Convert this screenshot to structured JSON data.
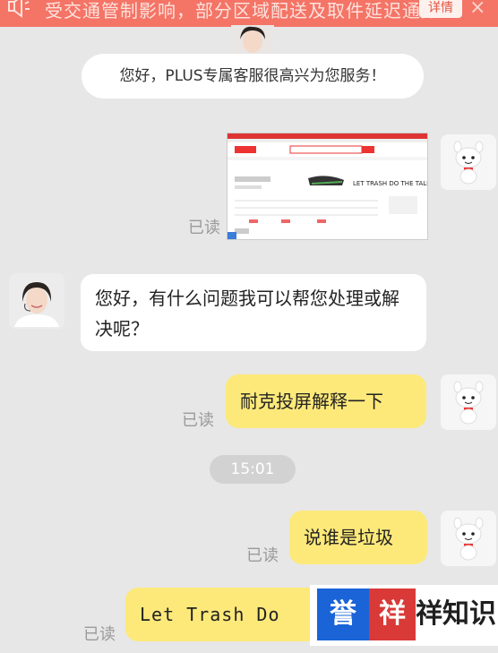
{
  "notice": {
    "text": "受交通管制影响，部分区域配送及取件延迟通知",
    "details_label": "详情",
    "close_glyph": "×"
  },
  "welcome": "您好，PLUS专属客服很高兴为您服务！",
  "messages": {
    "agent_reply": "您好，有什么问题我可以帮您处理或解决呢？",
    "user_msg_1": "耐克投屏解释一下",
    "user_msg_2": "说谁是垃圾",
    "user_msg_3": "Let Trash Do"
  },
  "read_label": "已读",
  "time": "15:01",
  "screenshot_thumb": {
    "banner": "LET TRASH DO THE TALK."
  },
  "watermark": {
    "badge1": "誉",
    "badge2": "祥",
    "text": "祥知识"
  },
  "colors": {
    "notice_bg": "#f47466",
    "user_bubble": "#fde97a",
    "agent_bubble": "#ffffff",
    "page_bg": "#e7e7e7"
  }
}
